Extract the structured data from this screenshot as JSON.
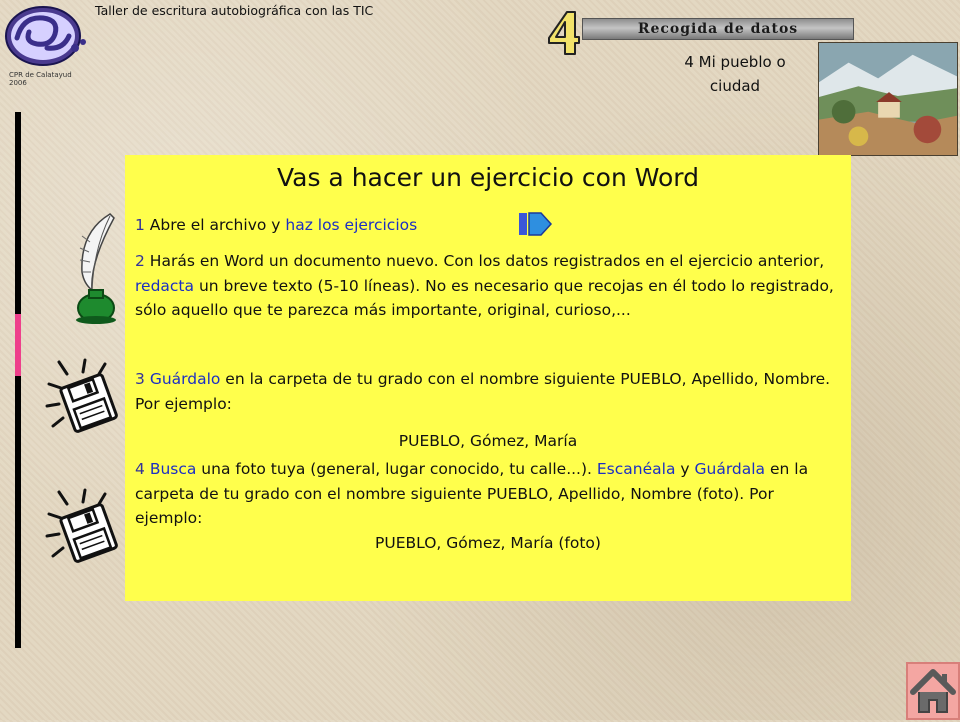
{
  "header": {
    "course_title": "Taller de escritura autobiográfica con las TIC",
    "org_line1": "CPR de Calatayud",
    "org_line2": "2006",
    "section_number": "4",
    "banner_label": "Recogida de datos",
    "lesson_line1": "4 Mi pueblo o",
    "lesson_line2": "ciudad"
  },
  "panel": {
    "title": "Vas a hacer un ejercicio con Word",
    "step1": {
      "num": "1",
      "text_a": " Abre el archivo y ",
      "link": "haz los ejercicios"
    },
    "step2": {
      "num": "2",
      "text_a": " Harás en Word un documento nuevo. Con los datos registrados en el ejercicio anterior, ",
      "link": "redacta",
      "text_b": " un breve texto (5-10 líneas). No es necesario que recojas en él todo lo registrado, sólo aquello que te parezca más importante, original, curioso,..."
    },
    "step3": {
      "num": "3",
      "link": "Guárdalo",
      "text_a": "  en la carpeta de tu grado con el nombre siguiente PUEBLO, Apellido, Nombre. Por ejemplo:",
      "example": "PUEBLO, Gómez, María"
    },
    "step4": {
      "num": "4",
      "link_a": "Busca",
      "text_a": " una foto tuya (general, lugar conocido, tu calle...). ",
      "link_b": "Escanéala",
      "text_b": " y ",
      "link_c": "Guárdala",
      "text_c": "  en la carpeta de tu grado con el nombre siguiente PUEBLO, Apellido, Nombre (foto). Por ejemplo:",
      "example": "PUEBLO, Gómez, María (foto)"
    }
  },
  "icons": {
    "logo": "cpr-logo-icon",
    "next": "next-arrow-icon",
    "quill": "quill-inkwell-icon",
    "save": "floppy-disk-icon",
    "home": "home-icon"
  },
  "colors": {
    "panel_bg": "#ffff4c",
    "link": "#1c2fc4",
    "number": "#333399",
    "accent_pink": "#ee3f8b",
    "home_button": "#f4a6a2"
  }
}
